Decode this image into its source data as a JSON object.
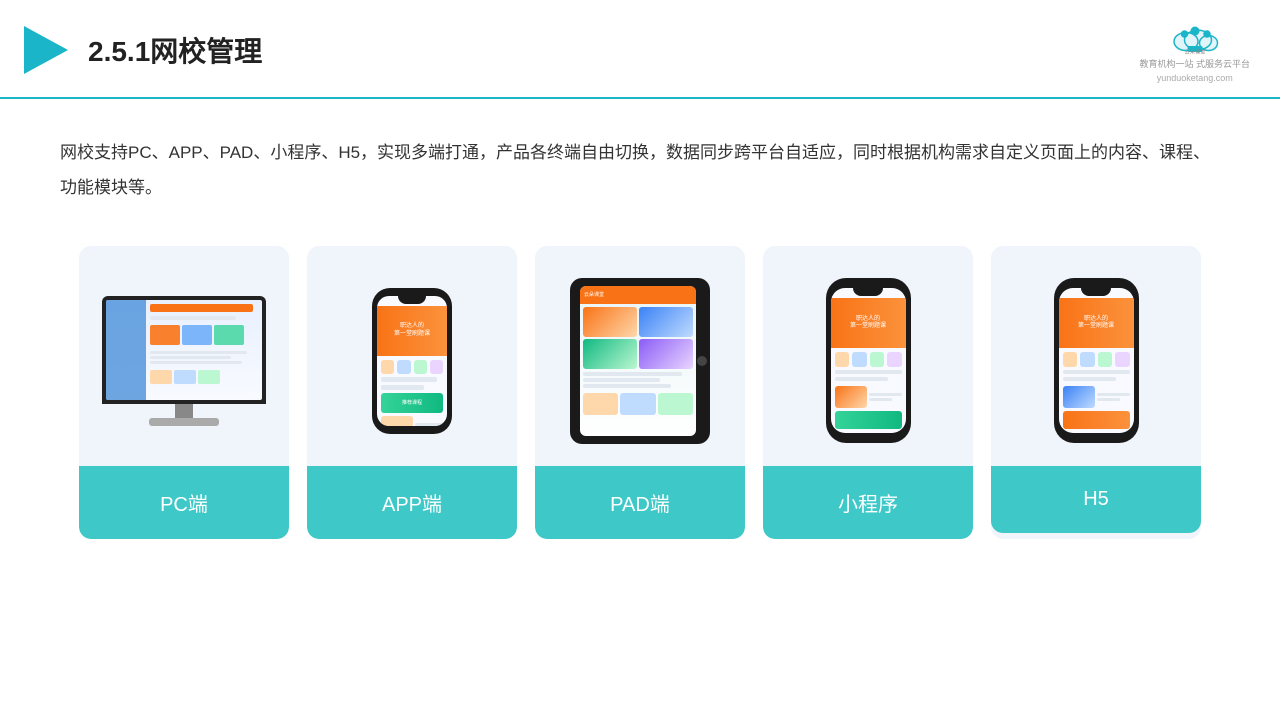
{
  "header": {
    "title": "2.5.1网校管理",
    "logo_url": "yunduoketang.com",
    "logo_tagline": "教育机构一站\n式服务云平台"
  },
  "description": {
    "text": "网校支持PC、APP、PAD、小程序、H5，实现多端打通，产品各终端自由切换，数据同步跨平台自适应，同时根据机构需求自定义页面上的内容、课程、功能模块等。"
  },
  "cards": [
    {
      "id": "pc",
      "label": "PC端"
    },
    {
      "id": "app",
      "label": "APP端"
    },
    {
      "id": "pad",
      "label": "PAD端"
    },
    {
      "id": "miniapp",
      "label": "小程序"
    },
    {
      "id": "h5",
      "label": "H5"
    }
  ],
  "accent_color": "#3ec8c8"
}
